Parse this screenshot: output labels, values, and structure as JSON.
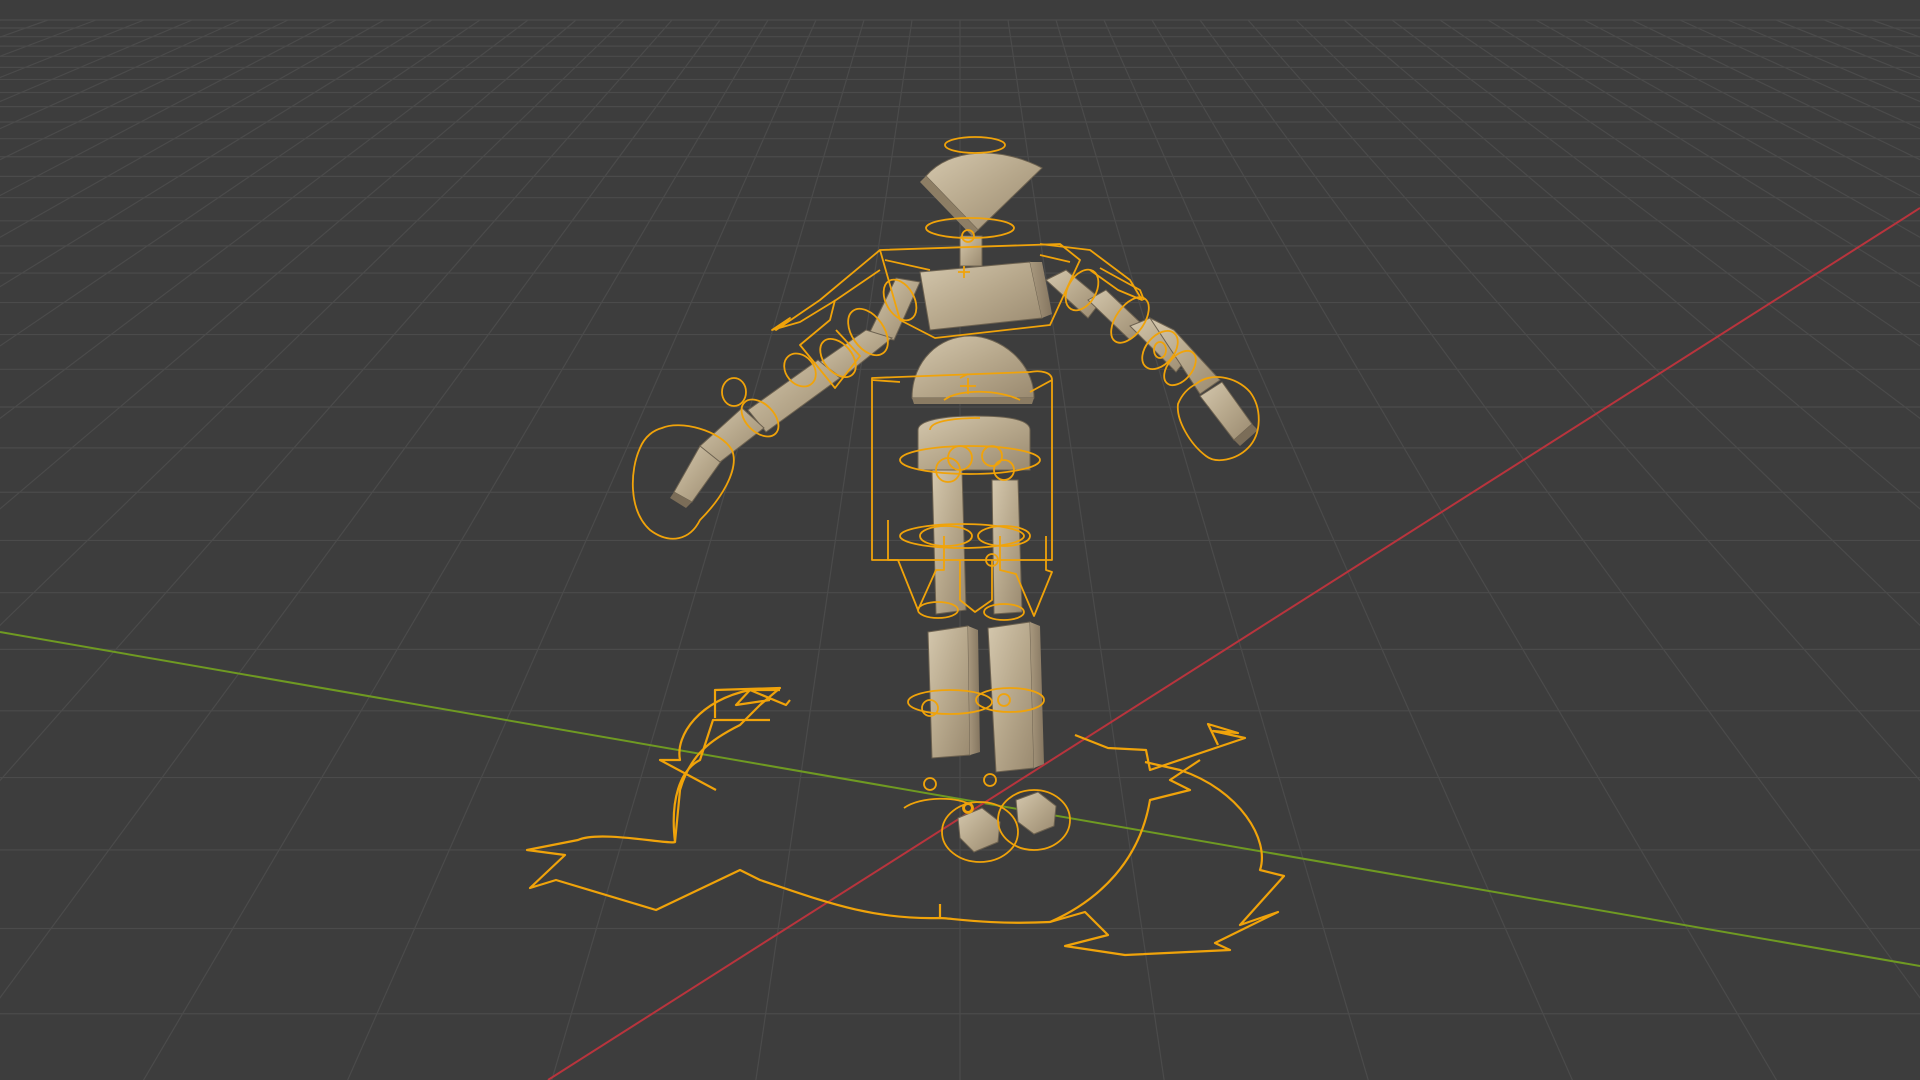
{
  "viewport": {
    "mode": "3d-viewport",
    "grid_visible": true,
    "axes": [
      {
        "name": "x-axis",
        "color": "#b8343d"
      },
      {
        "name": "y-axis",
        "color": "#6f9a22"
      }
    ]
  },
  "colors": {
    "background": "#3d3d3d",
    "grid_line": "#4a4a4a",
    "selection_outline": "#f0a30a",
    "wood_light": "#c9bba0",
    "wood_mid": "#a8987d",
    "wood_dark": "#8a7b63"
  },
  "scene": {
    "object": "wooden-mannequin-rig",
    "selected": true,
    "icons": [
      "root-control-icon",
      "head-control-icon",
      "foot-control-icon",
      "hand-control-icon"
    ]
  }
}
